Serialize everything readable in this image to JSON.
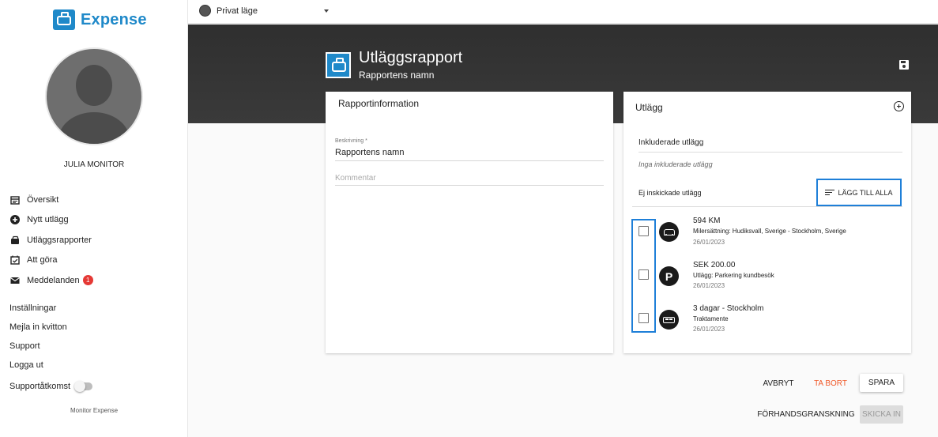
{
  "app": {
    "logo_text": "Expense",
    "brand_color": "#1f89c9",
    "footer": "Monitor Expense"
  },
  "topbar": {
    "mode_label": "Privat läge"
  },
  "user": {
    "name": "JULIA MONITOR"
  },
  "nav": [
    {
      "label": "Översikt",
      "icon": "calendar-icon"
    },
    {
      "label": "Nytt utlägg",
      "icon": "add-circle-icon"
    },
    {
      "label": "Utläggsrapporter",
      "icon": "wallet-icon"
    },
    {
      "label": "Att göra",
      "icon": "checklist-icon"
    },
    {
      "label": "Meddelanden",
      "icon": "mail-icon",
      "badge": "1"
    }
  ],
  "links": [
    "Inställningar",
    "Mejla in kvitton",
    "Support",
    "Logga ut"
  ],
  "support_access": {
    "label": "Supportåtkomst"
  },
  "report": {
    "title": "Utläggsrapport",
    "subtitle": "Rapportens namn"
  },
  "info_card": {
    "title": "Rapportinformation",
    "description_label": "Beskrivning *",
    "description_value": "Rapportens namn",
    "comment_placeholder": "Kommentar"
  },
  "expenses_card": {
    "title": "Utlägg",
    "included_label": "Inkluderade utlägg",
    "none_included": "Inga inkluderade utlägg",
    "not_submitted_label": "Ej inskickade utlägg",
    "add_all_label": "LÄGG TILL ALLA",
    "items": [
      {
        "title": "594 KM",
        "desc": "Milersättning: Hudiksvall, Sverige - Stockholm, Sverige",
        "date": "26/01/2023",
        "icon": "car-icon"
      },
      {
        "title": "SEK 200.00",
        "desc": "Utlägg: Parkering kundbesök",
        "date": "26/01/2023",
        "icon": "parking-icon",
        "glyph": "P"
      },
      {
        "title": "3 dagar - Stockholm",
        "desc": "Traktamente",
        "date": "26/01/2023",
        "icon": "bus-icon"
      }
    ]
  },
  "buttons": {
    "cancel": "AVBRYT",
    "delete": "TA BORT",
    "save": "SPARA",
    "preview": "FÖRHANDSGRANSKNING",
    "send": "SKICKA IN"
  },
  "colors": {
    "highlight": "#1e7fd8",
    "delete": "#f05a2a",
    "badge": "#e53935",
    "header": "#333333"
  }
}
